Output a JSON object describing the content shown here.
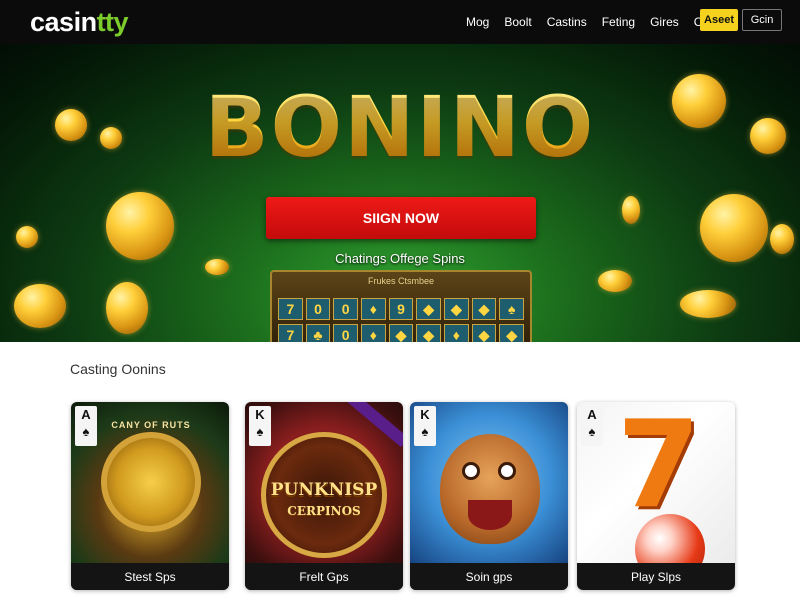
{
  "nav": {
    "logo": {
      "part1": "ca",
      "part2": "sin",
      "part3": "tty"
    },
    "links": [
      "Mog",
      "Boolt",
      "Castins",
      "Feting",
      "Gires",
      "Clit"
    ],
    "signin_label": "Aseet",
    "login_label": "Gcin"
  },
  "hero": {
    "title": "BONINO",
    "cta_label": "SIIGN NOW",
    "subtitle": "Chatings Offege Spins",
    "slot_header": "Frukes Ctsmbee"
  },
  "section": {
    "title": "Casting Oonins"
  },
  "cards": [
    {
      "label": "Stest Sps",
      "rank": "A",
      "suit": "♠",
      "art_text": "CANY OF RUTS"
    },
    {
      "label": "Frelt Gps",
      "rank": "K",
      "suit": "♠",
      "art_title": "PUNKNISP",
      "art_sub": "CERPINOS"
    },
    {
      "label": "Soin gps",
      "rank": "K",
      "suit": "♠"
    },
    {
      "label": "Play Slps",
      "rank": "A",
      "suit": "♠"
    }
  ],
  "colors": {
    "nav_bg": "#0b0b0b",
    "accent_yellow": "#f4d21e",
    "cta_red": "#e01410",
    "hero_green": "#1b6b1c",
    "gold": "#ffcf3a"
  }
}
